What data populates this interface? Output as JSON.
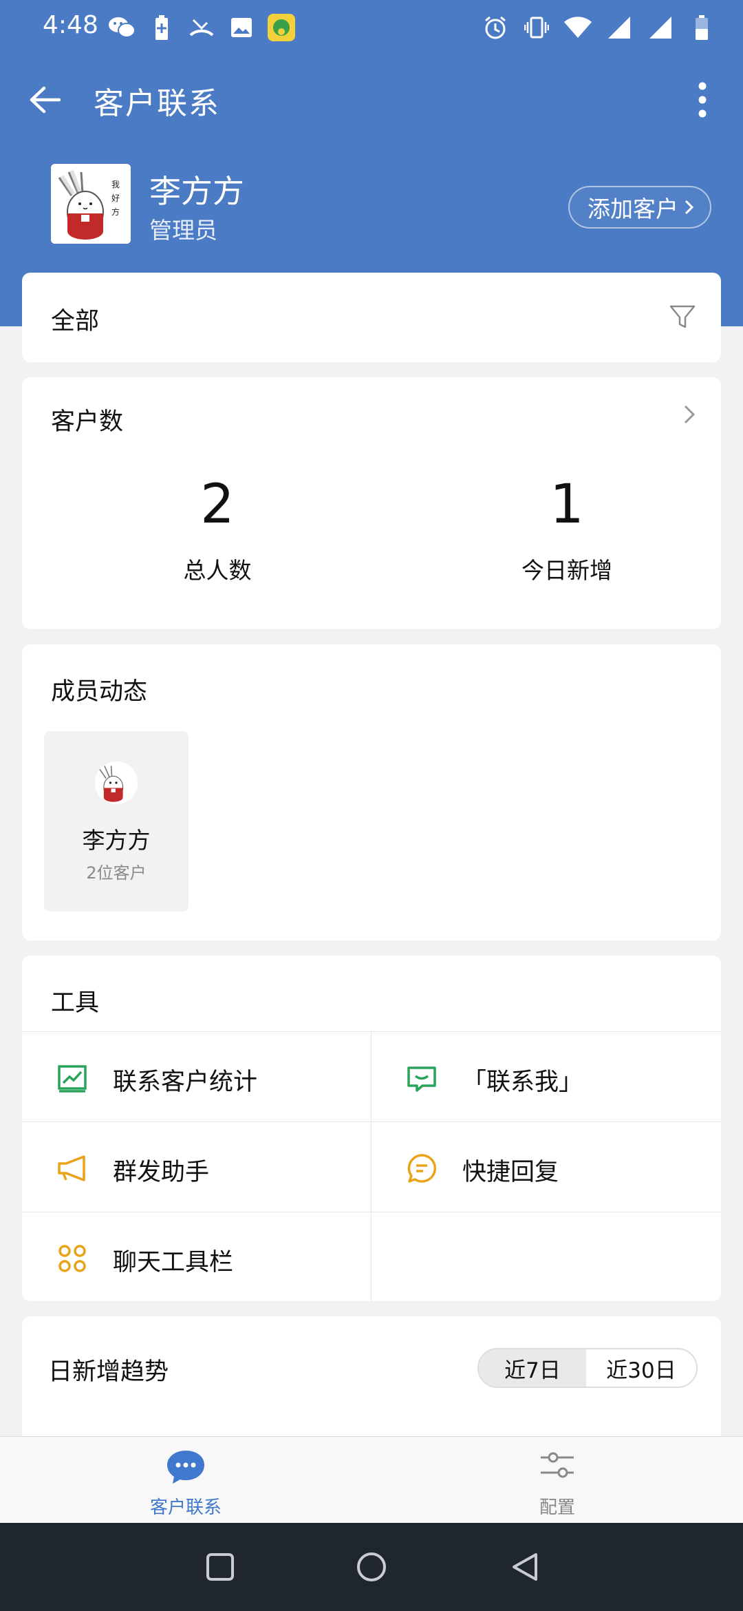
{
  "status_bar": {
    "time": "4:48",
    "left_icons": [
      "wechat-icon",
      "battery-saver-icon",
      "missed-call-icon",
      "image-icon",
      "app-notification-icon"
    ],
    "right_icons": [
      "alarm-icon",
      "vibrate-icon",
      "wifi-icon",
      "signal-icon",
      "signal-icon-2",
      "battery-icon"
    ]
  },
  "app_bar": {
    "title": "客户联系",
    "back_icon": "arrow-back-icon",
    "more_icon": "more-vertical-icon"
  },
  "profile": {
    "name": "李方方",
    "role": "管理员",
    "add_button": "添加客户",
    "add_button_icon": "chevron-right-icon"
  },
  "filter": {
    "label": "全部",
    "icon": "filter-icon"
  },
  "customer_count": {
    "title": "客户数",
    "total_value": "2",
    "total_label": "总人数",
    "today_value": "1",
    "today_label": "今日新增"
  },
  "member_activity": {
    "title": "成员动态",
    "members": [
      {
        "name": "李方方",
        "count": "2位客户"
      }
    ]
  },
  "tools": {
    "title": "工具",
    "items": [
      {
        "label": "联系客户统计",
        "icon": "chart-icon",
        "color": "#2aa35a"
      },
      {
        "label": "「联系我」",
        "icon": "message-icon",
        "color": "#2aa35a"
      },
      {
        "label": "群发助手",
        "icon": "megaphone-icon",
        "color": "#e8a319"
      },
      {
        "label": "快捷回复",
        "icon": "quick-reply-icon",
        "color": "#e8a319"
      },
      {
        "label": "聊天工具栏",
        "icon": "toolbar-grid-icon",
        "color": "#e8a319"
      }
    ]
  },
  "trend": {
    "title": "日新增趋势",
    "options": [
      "近7日",
      "近30日"
    ],
    "selected": "近7日"
  },
  "bottom_nav": {
    "items": [
      {
        "label": "客户联系",
        "icon": "chat-bubble-icon",
        "active": true
      },
      {
        "label": "配置",
        "icon": "settings-sliders-icon",
        "active": false
      }
    ]
  },
  "colors": {
    "header_blue": "#4a7bc4",
    "accent_blue": "#3f78cc",
    "green": "#2aa35a",
    "orange": "#e8a319"
  }
}
